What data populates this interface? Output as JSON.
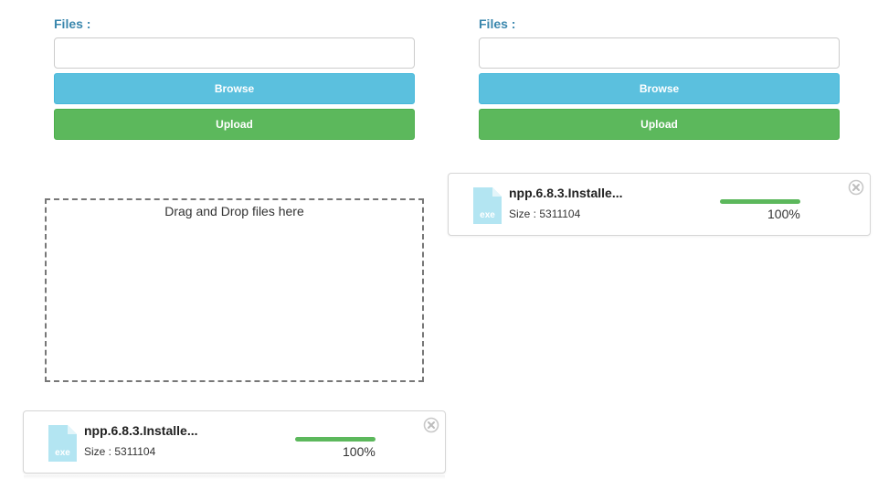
{
  "left_form": {
    "files_label": "Files :",
    "file_value": "",
    "browse_label": "Browse",
    "upload_label": "Upload"
  },
  "right_form": {
    "files_label": "Files :",
    "file_value": "",
    "browse_label": "Browse",
    "upload_label": "Upload"
  },
  "dropzone": {
    "text": "Drag and Drop files here"
  },
  "uploads": {
    "right": {
      "icon_text": "exe",
      "file_name": "npp.6.8.3.Installe...",
      "size_text": "Size : 5311104",
      "progress_percent": 100,
      "progress_label": "100%"
    },
    "left": {
      "icon_text": "exe",
      "file_name": "npp.6.8.3.Installe...",
      "size_text": "Size : 5311104",
      "progress_percent": 100,
      "progress_label": "100%"
    }
  },
  "colors": {
    "label_blue": "#3a87ad",
    "browse": "#5bc0de",
    "upload": "#5cb85c",
    "file_icon": "#b3e5f2",
    "progress": "#5cb85c"
  },
  "icons": {
    "file": "exe-file-icon",
    "close": "close-circle-icon"
  }
}
